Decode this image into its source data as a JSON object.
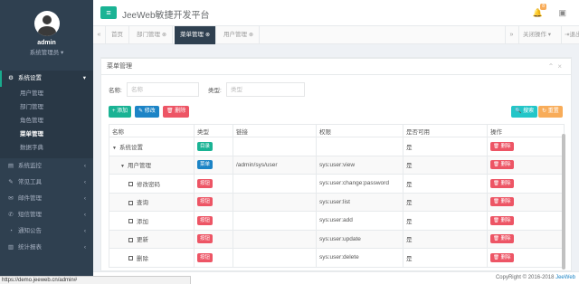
{
  "app": {
    "title": "JeeWeb敏捷开发平台",
    "notification_count": "8"
  },
  "profile": {
    "name": "admin",
    "role": "系统管理员 ▾"
  },
  "sidebar": {
    "groups": [
      {
        "label": "系统设置",
        "icon": "gear-icon",
        "active": true
      },
      {
        "label": "系统监控",
        "icon": "monitor-icon"
      },
      {
        "label": "常见工具",
        "icon": "wrench-icon"
      },
      {
        "label": "邮件管理",
        "icon": "mail-icon"
      },
      {
        "label": "短信管理",
        "icon": "sms-icon"
      },
      {
        "label": "通知公告",
        "icon": "bullhorn-icon"
      },
      {
        "label": "统计报表",
        "icon": "chart-icon"
      }
    ],
    "sub_items": [
      "用户管理",
      "部门管理",
      "角色管理",
      "菜单管理",
      "数据字典"
    ],
    "current_sub": "菜单管理"
  },
  "tabs": {
    "items": [
      "首页",
      "部门管理",
      "菜单管理",
      "用户管理"
    ],
    "close_glyph": "⊗",
    "close_ops": "关闭操作 ▾",
    "logout": "退出"
  },
  "panel": {
    "title": "菜单管理"
  },
  "search": {
    "name_label": "名称:",
    "name_placeholder": "名称",
    "type_label": "类型:",
    "type_placeholder": "类型"
  },
  "toolbar": {
    "add": "+ 添加",
    "edit": "✎ 修改",
    "delete": "🗑 删除",
    "search": "🔍 搜索",
    "reset": "↻ 重置"
  },
  "table": {
    "headers": [
      "名称",
      "类型",
      "链接",
      "权限",
      "是否可用",
      "操作"
    ],
    "delete_label": "🗑 删除",
    "rows": [
      {
        "name": "系统设置",
        "type": "目录",
        "type_color": "#1ab394",
        "link": "",
        "permission": "",
        "enabled": "是",
        "level": 0,
        "expander": "▼"
      },
      {
        "name": "用户管理",
        "type": "菜单",
        "type_color": "#1c84c6",
        "link": "/admin/sys/user",
        "permission": "sys:user:view",
        "enabled": "是",
        "level": 1,
        "expander": "▼"
      },
      {
        "name": "修改密码",
        "type": "按钮",
        "type_color": "#ed5565",
        "link": "",
        "permission": "sys:user:change:password",
        "enabled": "是",
        "level": 2
      },
      {
        "name": "查询",
        "type": "按钮",
        "type_color": "#ed5565",
        "link": "",
        "permission": "sys:user:list",
        "enabled": "是",
        "level": 2
      },
      {
        "name": "添加",
        "type": "按钮",
        "type_color": "#ed5565",
        "link": "",
        "permission": "sys:user:add",
        "enabled": "是",
        "level": 2
      },
      {
        "name": "更新",
        "type": "按钮",
        "type_color": "#ed5565",
        "link": "",
        "permission": "sys:user:update",
        "enabled": "是",
        "level": 2
      },
      {
        "name": "删除",
        "type": "按钮",
        "type_color": "#ed5565",
        "link": "",
        "permission": "sys:user:delete",
        "enabled": "是",
        "level": 2
      }
    ]
  },
  "footer": {
    "copyright": "CopyRight © 2016-2018 ",
    "brand": "JeeWeb"
  },
  "status_url": "https://demo.jeeweb.cn/admin#"
}
